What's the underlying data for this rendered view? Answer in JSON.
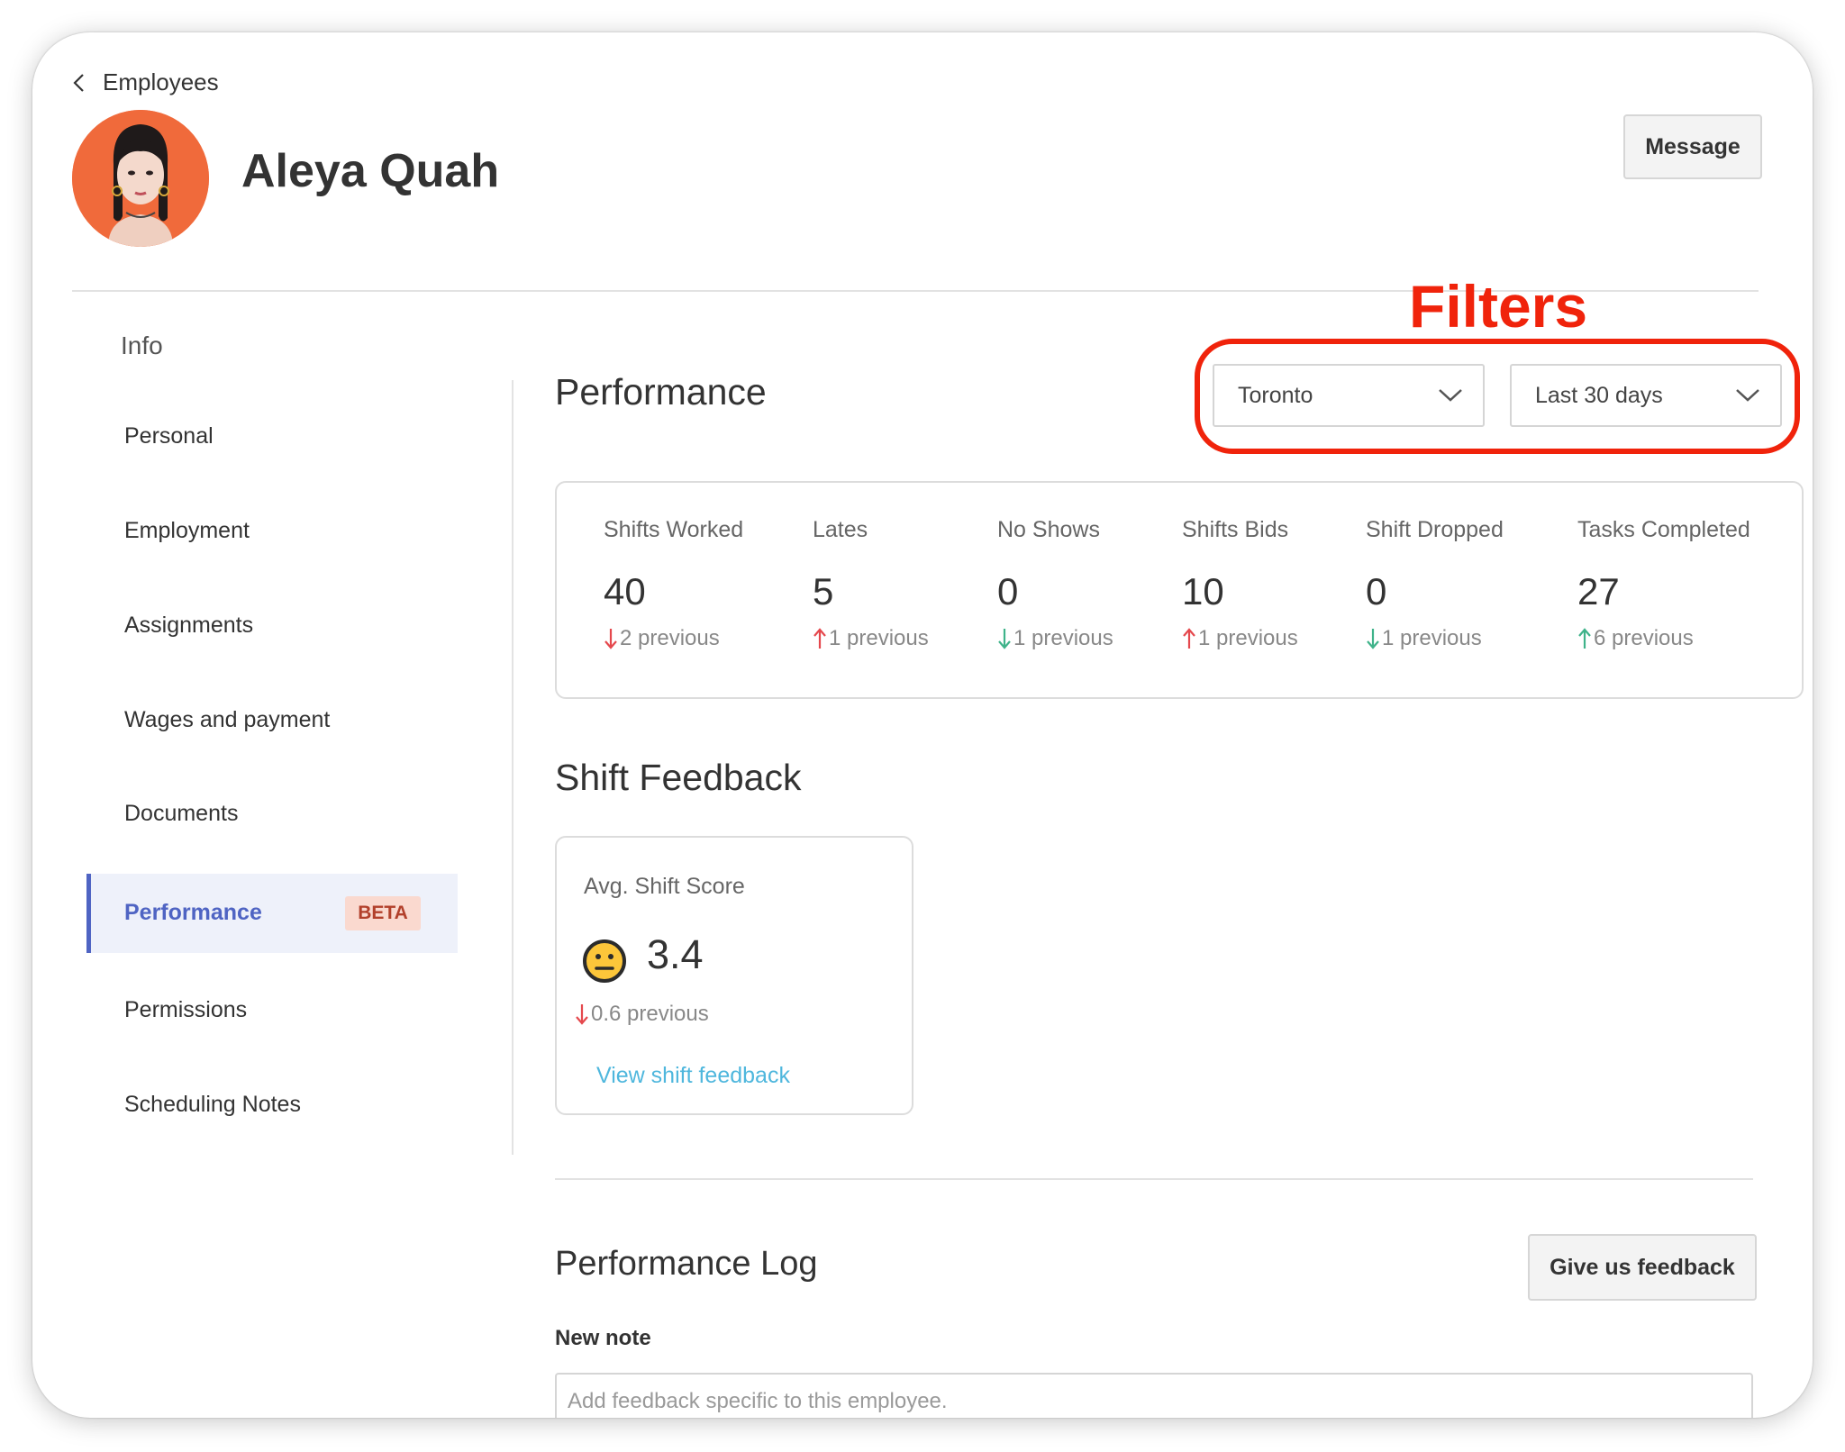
{
  "header": {
    "back_label": "Employees",
    "employee_name": "Aleya Quah",
    "message_button": "Message"
  },
  "sidebar": {
    "heading": "Info",
    "items": [
      {
        "label": "Personal"
      },
      {
        "label": "Employment"
      },
      {
        "label": "Assignments"
      },
      {
        "label": "Wages and payment"
      },
      {
        "label": "Documents"
      },
      {
        "label": "Performance",
        "active": true,
        "badge": "BETA"
      },
      {
        "label": "Permissions"
      },
      {
        "label": "Scheduling Notes"
      }
    ]
  },
  "annotation": {
    "label": "Filters",
    "color": "#f0230b"
  },
  "performance": {
    "title": "Performance",
    "filters": {
      "location": "Toronto",
      "period": "Last 30 days"
    },
    "stats": [
      {
        "label": "Shifts Worked",
        "value": "40",
        "trend": "down",
        "trend_color": "#e5484d",
        "previous": "2 previous"
      },
      {
        "label": "Lates",
        "value": "5",
        "trend": "up",
        "trend_color": "#e5484d",
        "previous": "1 previous"
      },
      {
        "label": "No Shows",
        "value": "0",
        "trend": "down",
        "trend_color": "#3fb38a",
        "previous": "1 previous"
      },
      {
        "label": "Shifts Bids",
        "value": "10",
        "trend": "up",
        "trend_color": "#e5484d",
        "previous": "1 previous"
      },
      {
        "label": "Shift Dropped",
        "value": "0",
        "trend": "down",
        "trend_color": "#3fb38a",
        "previous": "1 previous"
      },
      {
        "label": "Tasks Completed",
        "value": "27",
        "trend": "up",
        "trend_color": "#3fb38a",
        "previous": "6 previous"
      }
    ]
  },
  "shift_feedback": {
    "title": "Shift Feedback",
    "card_label": "Avg. Shift Score",
    "emoji": "neutral-face-icon",
    "score": "3.4",
    "trend": "down",
    "trend_color": "#e5484d",
    "previous": "0.6 previous",
    "link": "View shift feedback"
  },
  "performance_log": {
    "title": "Performance Log",
    "feedback_button": "Give us feedback",
    "note_label": "New note",
    "note_placeholder": "Add feedback specific to this employee.",
    "note_value": ""
  },
  "colors": {
    "accent": "#4f64c3",
    "link": "#4fb7dd",
    "badge_bg": "#fad9cf",
    "badge_text": "#b2402b"
  }
}
